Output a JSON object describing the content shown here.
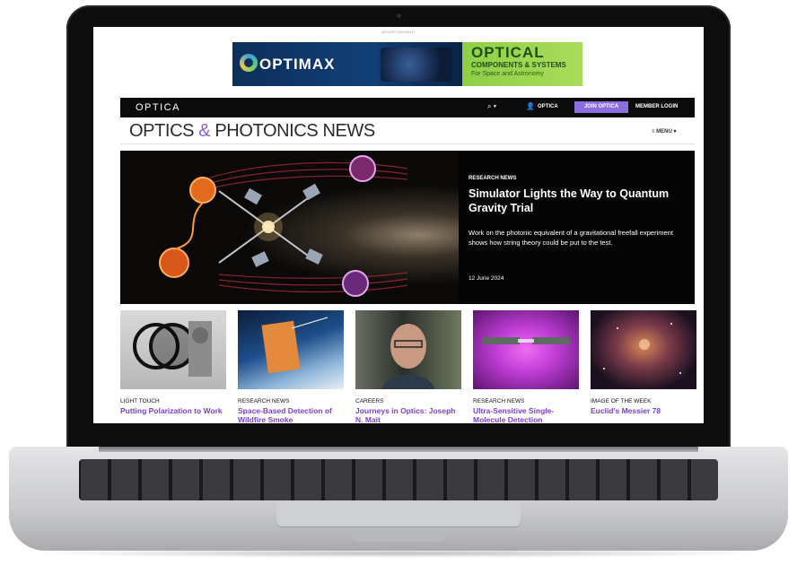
{
  "ad": {
    "label": "ADVERTISEMENT",
    "brand": "OPTIMAX",
    "headline": "OPTICAL",
    "subheadline": "COMPONENTS & SYSTEMS",
    "tagline": "For Space and Astronomy"
  },
  "topbar": {
    "logo": "OPTICA",
    "search_icon": "⌕ ▾",
    "user_icon": "👤",
    "user_label": "OPTICA",
    "join_label": "JOIN OPTICA",
    "login_label": "MEMBER LOGIN"
  },
  "masthead": {
    "title_part1": "OPTICS",
    "title_amp": "&",
    "title_part2": "PHOTONICS NEWS",
    "menu_label": "≡ MENU ▾"
  },
  "hero": {
    "kicker": "RESEARCH NEWS",
    "title": "Simulator Lights the Way to Quantum Gravity Trial",
    "description": "Work on the photonic equivalent of a gravitational freefall experiment shows how string theory could be put to the test.",
    "date": "12 June 2024"
  },
  "cards": [
    {
      "kicker": "LIGHT TOUCH",
      "title": "Putting Polarization to Work"
    },
    {
      "kicker": "RESEARCH NEWS",
      "title": "Space-Based Detection of Wildfire Smoke"
    },
    {
      "kicker": "CAREERS",
      "title": "Journeys in Optics: Joseph N. Mait"
    },
    {
      "kicker": "RESEARCH NEWS",
      "title": "Ultra-Sensitive Single-Molecule Detection"
    },
    {
      "kicker": "IMAGE OF THE WEEK",
      "title": "Euclid's Messier 78"
    }
  ],
  "colors": {
    "accent": "#8a6fdc",
    "link": "#7b3fd6",
    "topbar": "#0b0b0c"
  }
}
